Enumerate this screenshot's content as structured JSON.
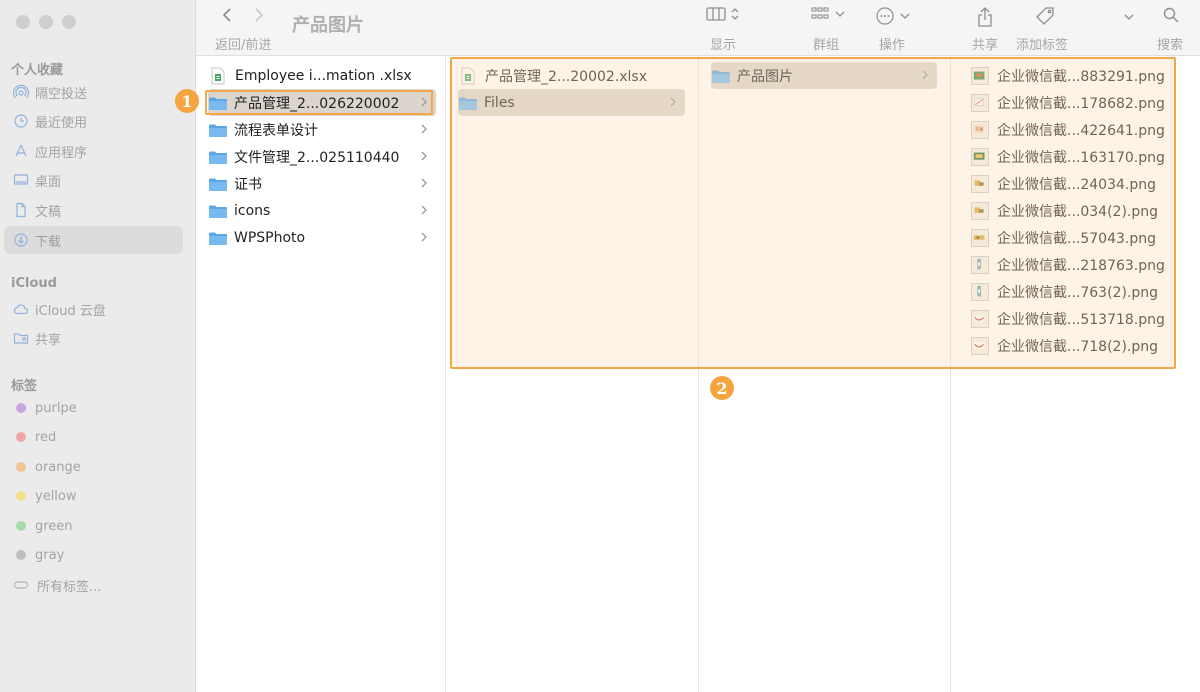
{
  "colors": {
    "accent": "#f5a540",
    "selection": "#dbd5ce",
    "folder": "#6fb0e8"
  },
  "sidebar": {
    "favorites_title": "个人收藏",
    "favorites": [
      {
        "label": "隔空投送",
        "icon": "airdrop-icon"
      },
      {
        "label": "最近使用",
        "icon": "clock-icon"
      },
      {
        "label": "应用程序",
        "icon": "apps-icon"
      },
      {
        "label": "桌面",
        "icon": "desktop-icon"
      },
      {
        "label": "文稿",
        "icon": "document-icon"
      },
      {
        "label": "下载",
        "icon": "download-icon",
        "selected": true
      }
    ],
    "icloud_title": "iCloud",
    "icloud": [
      {
        "label": "iCloud 云盘",
        "icon": "cloud-icon"
      },
      {
        "label": "共享",
        "icon": "shared-folder-icon"
      }
    ],
    "tags_title": "标签",
    "tags": [
      {
        "label": "purlpe",
        "color": "#c9a4e0"
      },
      {
        "label": "red",
        "color": "#f0a6a6"
      },
      {
        "label": "orange",
        "color": "#f2c493"
      },
      {
        "label": "yellow",
        "color": "#f0e08f"
      },
      {
        "label": "green",
        "color": "#a6dba8"
      },
      {
        "label": "gray",
        "color": "#bdbdbd"
      },
      {
        "label": "所有标签...",
        "icon": "all-tags-icon"
      }
    ]
  },
  "toolbar": {
    "title": "产品图片",
    "nav_label": "返回/前进",
    "view_label": "显示",
    "group_label": "群组",
    "action_label": "操作",
    "share_label": "共享",
    "tag_label": "添加标签",
    "search_label": "搜索"
  },
  "columns": [
    {
      "items": [
        {
          "name": "Employee i...mation  .xlsx",
          "type": "xlsx"
        },
        {
          "name": "产品管理_2...026220002",
          "type": "folder",
          "selected": true
        },
        {
          "name": "流程表单设计",
          "type": "folder"
        },
        {
          "name": "文件管理_2...025110440",
          "type": "folder"
        },
        {
          "name": "证书",
          "type": "folder"
        },
        {
          "name": "icons",
          "type": "folder"
        },
        {
          "name": "WPSPhoto",
          "type": "folder"
        }
      ]
    },
    {
      "items": [
        {
          "name": "产品管理_2...20002.xlsx",
          "type": "xlsx"
        },
        {
          "name": "Files",
          "type": "folder",
          "selected": true
        }
      ]
    },
    {
      "items": [
        {
          "name": "产品图片",
          "type": "folder",
          "selected": true
        }
      ]
    },
    {
      "items": [
        {
          "name": "企业微信截...883291.png"
        },
        {
          "name": "企业微信截...178682.png"
        },
        {
          "name": "企业微信截...422641.png"
        },
        {
          "name": "企业微信截...163170.png"
        },
        {
          "name": "企业微信截...24034.png"
        },
        {
          "name": "企业微信截...034(2).png"
        },
        {
          "name": "企业微信截...57043.png"
        },
        {
          "name": "企业微信截...218763.png"
        },
        {
          "name": "企业微信截...763(2).png"
        },
        {
          "name": "企业微信截...513718.png"
        },
        {
          "name": "企业微信截...718(2).png"
        }
      ]
    }
  ],
  "badges": [
    "1",
    "2"
  ]
}
